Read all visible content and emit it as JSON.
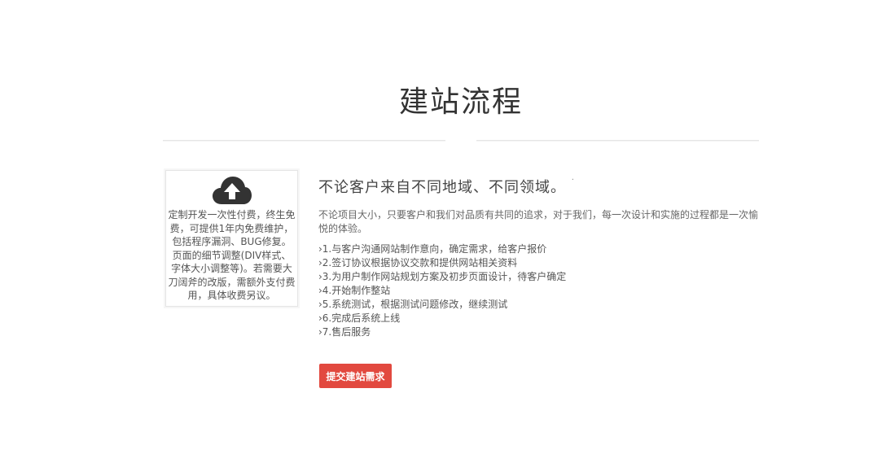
{
  "header": {
    "title": "建站流程"
  },
  "card": {
    "icon": "cloud-upload-icon",
    "description": "定制开发一次性付费，终生免费，可提供1年内免费维护，包括程序漏洞、BUG修复。页面的细节调整(DIV样式、字体大小调整等)。若需要大刀阔斧的改版，需额外支付费用，具体收费另议。"
  },
  "content": {
    "headline": "不论客户来自不同地域、不同领域。",
    "headline_mark": "·",
    "intro": "不论项目大小，只要客户和我们对品质有共同的追求，对于我们，每一次设计和实施的过程都是一次愉悦的体验。",
    "steps": [
      "›1.与客户沟通网站制作意向，确定需求，给客户报价",
      "›2.签订协议根据协议交款和提供网站相关资料",
      "›3.为用户制作网站规划方案及初步页面设计，待客户确定",
      "›4.开始制作整站",
      "›5.系统测试，根据测试问题修改，继续测试",
      "›6.完成后系统上线",
      "›7.售后服务"
    ]
  },
  "actions": {
    "submit_label": "提交建站需求"
  },
  "colors": {
    "accent": "#e2493f",
    "icon": "#333333",
    "divider": "#e6e6e6"
  }
}
